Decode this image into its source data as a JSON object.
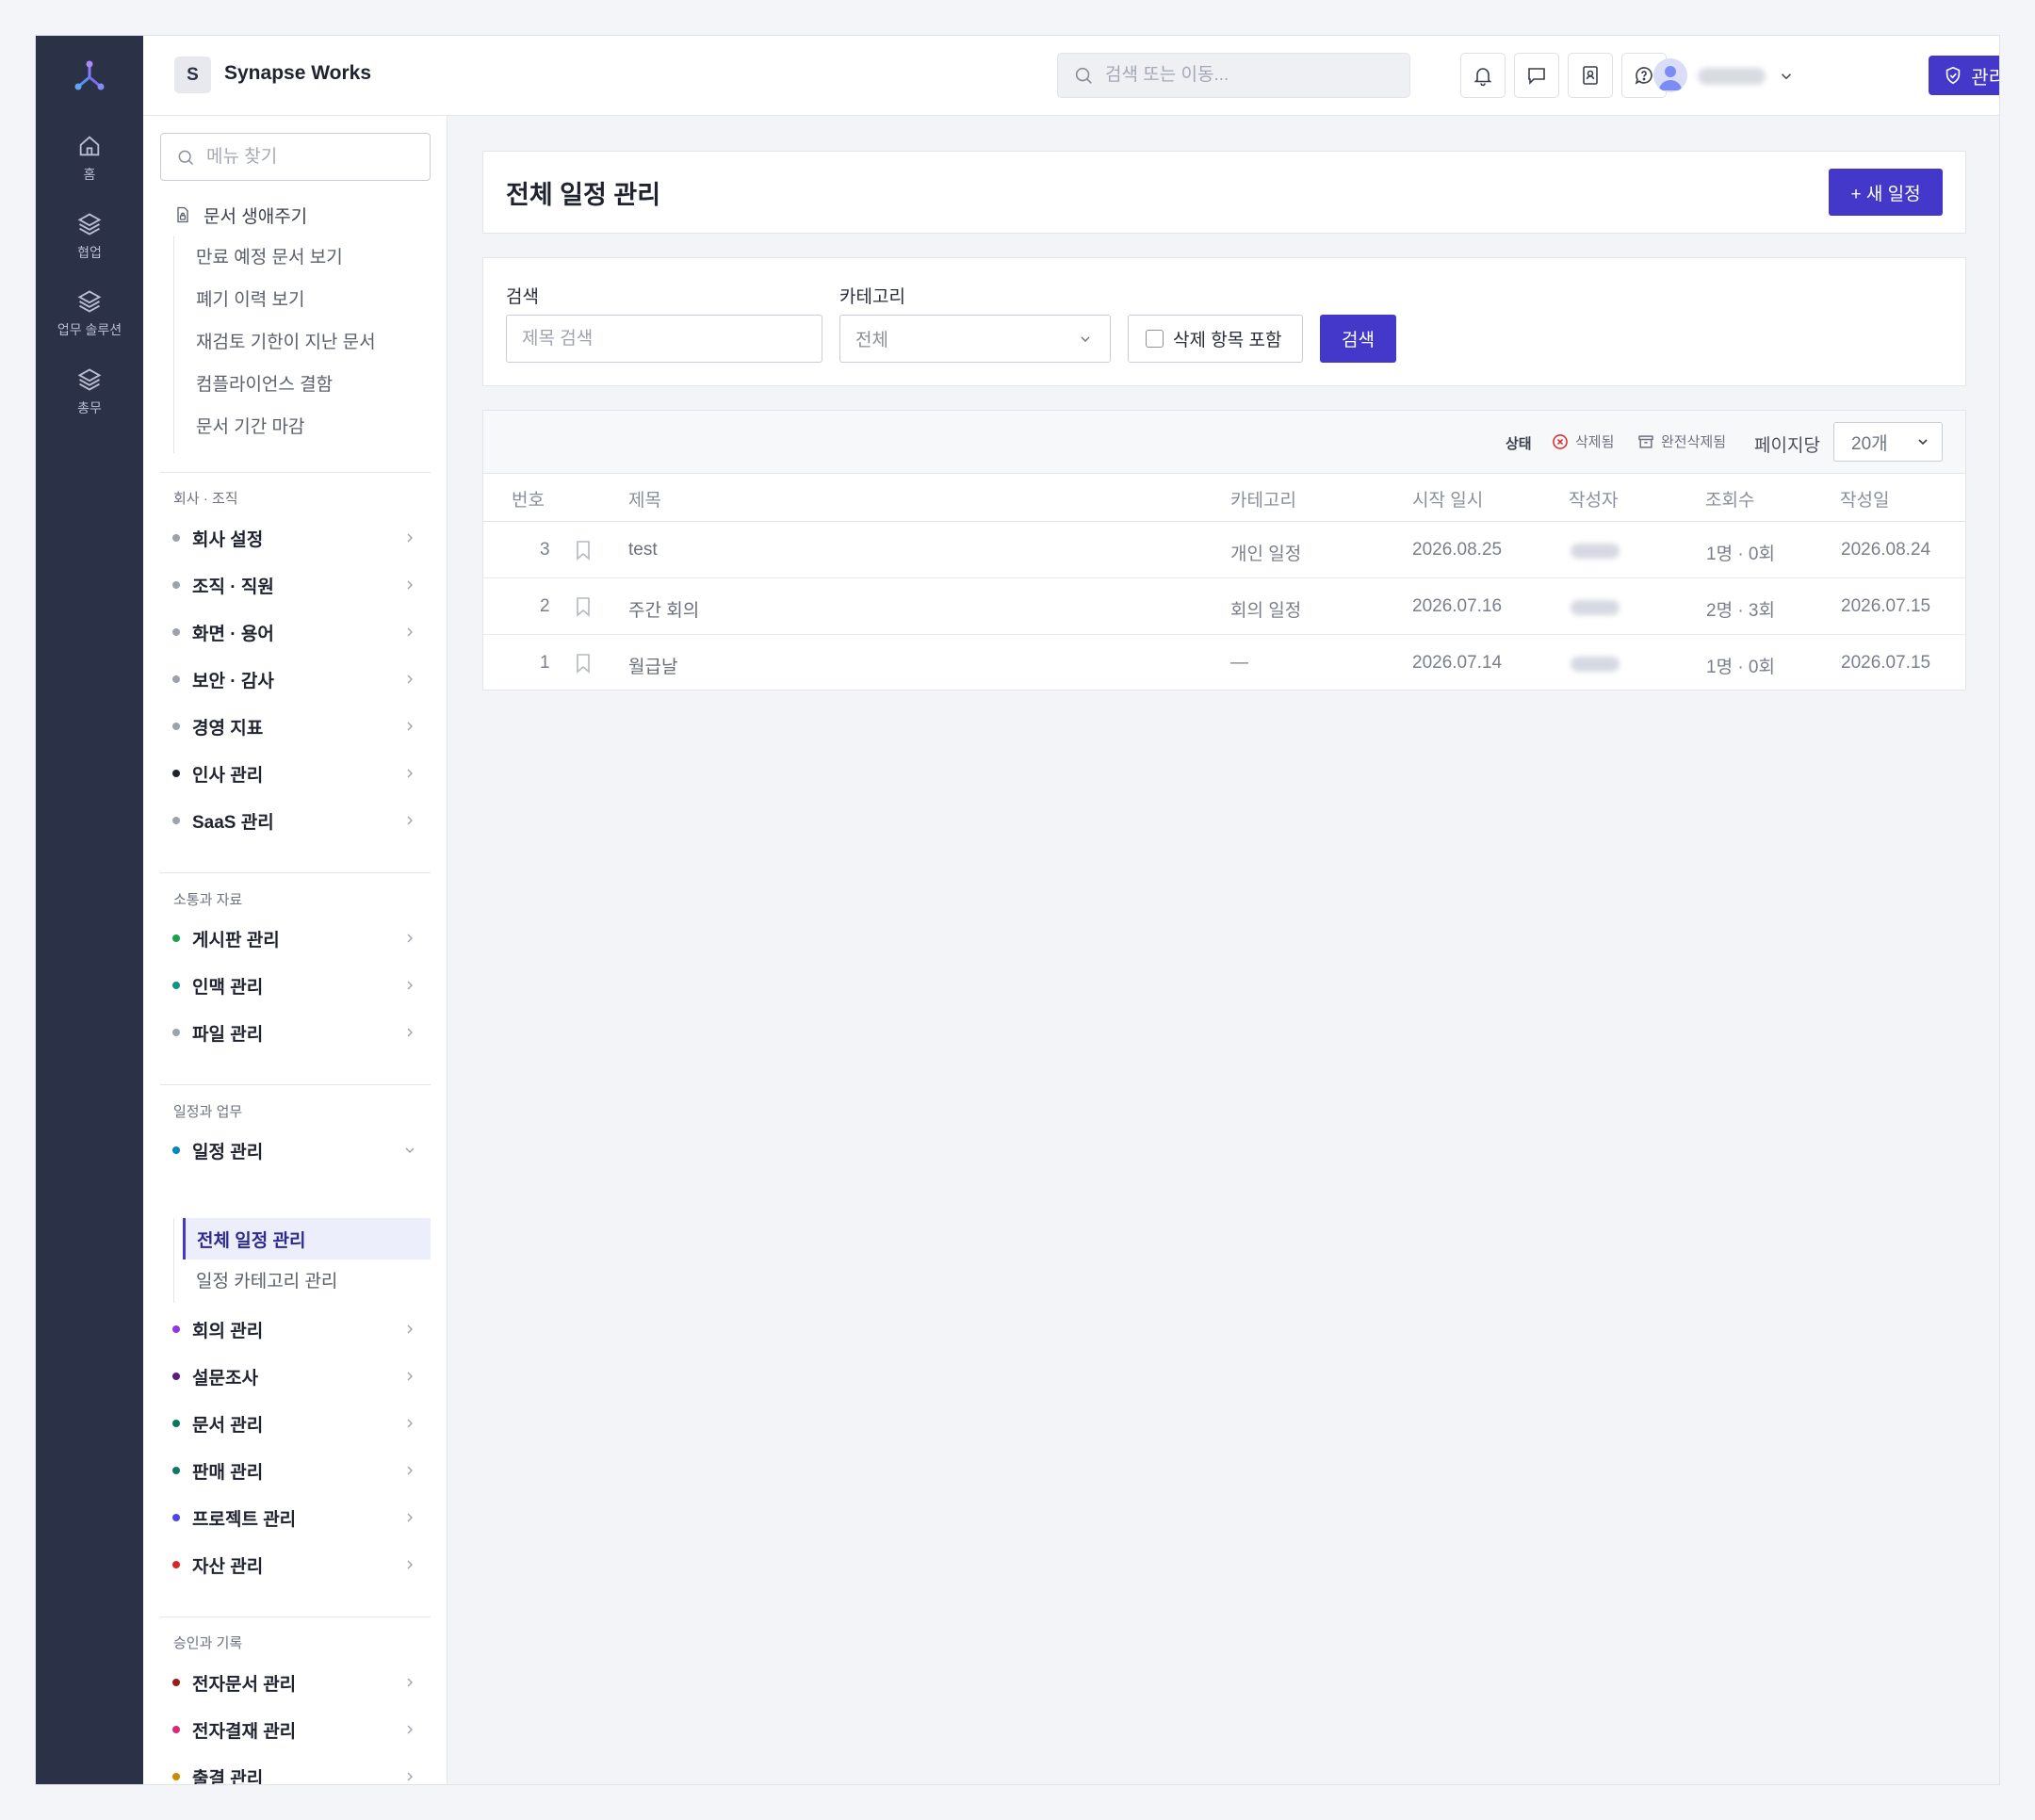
{
  "rail": {
    "items": [
      {
        "label": "홈",
        "icon": "home-icon"
      },
      {
        "label": "협업",
        "icon": "layers-icon"
      },
      {
        "label": "업무 솔루션",
        "icon": "layers-icon"
      },
      {
        "label": "총무",
        "icon": "layers-icon"
      }
    ]
  },
  "header": {
    "org_initial": "S",
    "org_name": "Synapse Works",
    "search_placeholder": "검색 또는 이동...",
    "icons": [
      "bell-icon",
      "chat-icon",
      "contacts-icon",
      "help-icon"
    ],
    "user_name": "●●●●",
    "admin_button": "관리자 메뉴"
  },
  "sidemenu": {
    "search_placeholder": "메뉴 찾기",
    "doc_lifecycle": {
      "label": "문서 생애주기",
      "items": [
        "만료 예정 문서 보기",
        "폐기 이력 보기",
        "재검토 기한이 지난 문서",
        "컴플라이언스 결함",
        "문서 기간 마감"
      ]
    },
    "sections": [
      {
        "title": "회사 · 조직",
        "items": [
          {
            "label": "회사 설정",
            "color": "#9ca3af"
          },
          {
            "label": "조직 · 직원",
            "color": "#9ca3af"
          },
          {
            "label": "화면 · 용어",
            "color": "#9ca3af"
          },
          {
            "label": "보안 · 감사",
            "color": "#9ca3af"
          },
          {
            "label": "경영 지표",
            "color": "#9ca3af"
          },
          {
            "label": "인사 관리",
            "color": "#1f2330"
          },
          {
            "label": "SaaS 관리",
            "color": "#9ca3af"
          }
        ]
      },
      {
        "title": "소통과 자료",
        "items": [
          {
            "label": "게시판 관리",
            "color": "#16a34a"
          },
          {
            "label": "인맥 관리",
            "color": "#0d9488"
          },
          {
            "label": "파일 관리",
            "color": "#9ca3af"
          }
        ]
      },
      {
        "title": "일정과 업무",
        "expanded": {
          "label": "일정 관리",
          "color": "#0284c7",
          "children": [
            "전체 일정 관리",
            "일정 카테고리 관리"
          ]
        },
        "items": [
          {
            "label": "회의 관리",
            "color": "#9333ea"
          },
          {
            "label": "설문조사",
            "color": "#581c87"
          },
          {
            "label": "문서 관리",
            "color": "#047857"
          },
          {
            "label": "판매 관리",
            "color": "#0f766e"
          },
          {
            "label": "프로젝트 관리",
            "color": "#4f46e5"
          },
          {
            "label": "자산 관리",
            "color": "#dc2626"
          }
        ]
      },
      {
        "title": "승인과 기록",
        "items": [
          {
            "label": "전자문서 관리",
            "color": "#991b1b"
          },
          {
            "label": "전자결재 관리",
            "color": "#db2777"
          },
          {
            "label": "출결 관리",
            "color": "#ca8a04"
          }
        ]
      }
    ]
  },
  "page": {
    "title": "전체 일정 관리",
    "new_button": "+ 새 일정"
  },
  "filters": {
    "search_label": "검색",
    "search_placeholder": "제목 검색",
    "category_label": "카테고리",
    "category_value": "전체",
    "include_deleted": "삭제 항목 포함",
    "search_button": "검색"
  },
  "table": {
    "status_label": "상태",
    "legend_deleted": "삭제됨",
    "legend_purged": "완전삭제됨",
    "per_page_label": "페이지당",
    "per_page_value": "20개",
    "columns": [
      "번호",
      "제목",
      "카테고리",
      "시작 일시",
      "작성자",
      "조회수",
      "작성일"
    ],
    "rows": [
      {
        "no": "3",
        "title": "test",
        "category": "개인 일정",
        "start": "2026.08.25",
        "author": "●●●",
        "views": "1명 · 0회",
        "created": "2026.08.24"
      },
      {
        "no": "2",
        "title": "주간 회의",
        "category": "회의 일정",
        "start": "2026.07.16",
        "author": "●●●",
        "views": "2명 · 3회",
        "created": "2026.07.15"
      },
      {
        "no": "1",
        "title": "월급날",
        "category": "—",
        "start": "2026.07.14",
        "author": "●●●",
        "views": "1명 · 0회",
        "created": "2026.07.15"
      }
    ]
  },
  "colors": {
    "accent": "#4338ca",
    "rail": "#2b3147"
  }
}
